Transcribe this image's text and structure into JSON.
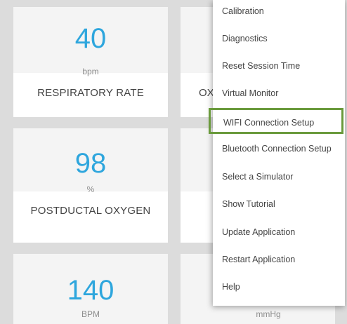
{
  "tiles": {
    "respiratory": {
      "value": "40",
      "unit": "bpm",
      "label": "RESPIRATORY RATE"
    },
    "oxygen_partial": {
      "label": "OX"
    },
    "postductal": {
      "value": "98",
      "unit": "%",
      "label": "POSTDUCTAL OXYGEN"
    },
    "heart": {
      "value": "140",
      "unit": "BPM"
    },
    "pressure": {
      "unit": "mmHg"
    }
  },
  "menu": {
    "items": [
      {
        "label": "Calibration"
      },
      {
        "label": "Diagnostics"
      },
      {
        "label": "Reset Session Time"
      },
      {
        "label": "Virtual Monitor"
      },
      {
        "label": "WIFI Connection Setup"
      },
      {
        "label": "Bluetooth Connection Setup"
      },
      {
        "label": "Select a Simulator"
      },
      {
        "label": "Show Tutorial"
      },
      {
        "label": "Update Application"
      },
      {
        "label": "Restart Application"
      },
      {
        "label": "Help"
      }
    ],
    "highlight_color": "#6a9a3c"
  },
  "colors": {
    "value_blue": "#2ea6dd",
    "background_gray": "#dcdcdc"
  }
}
